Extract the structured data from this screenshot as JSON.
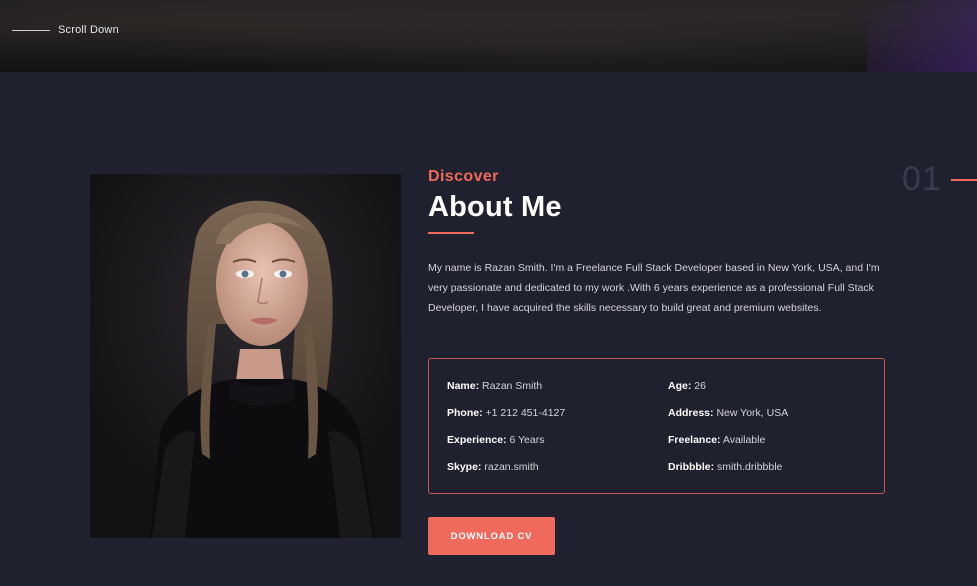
{
  "hero": {
    "scroll_label": "Scroll Down"
  },
  "about": {
    "eyebrow": "Discover",
    "title": "About Me",
    "section_number": "01",
    "bio": "My name is Razan Smith. I'm a Freelance Full Stack Developer based in New York, USA, and I'm very passionate and dedicated to my work .With 6 years experience as a professional Full Stack Developer, I have acquired the skills necessary to build great and premium websites.",
    "info": [
      {
        "label": "Name:",
        "value": "Razan Smith"
      },
      {
        "label": "Age:",
        "value": "26"
      },
      {
        "label": "Phone:",
        "value": "+1 212 451-4127"
      },
      {
        "label": "Address:",
        "value": "New York, USA"
      },
      {
        "label": "Experience:",
        "value": "6 Years"
      },
      {
        "label": "Freelance:",
        "value": "Available"
      },
      {
        "label": "Skype:",
        "value": "razan.smith"
      },
      {
        "label": "Dribbble:",
        "value": "smith.dribbble"
      }
    ],
    "download_label": "DOWNLOAD CV"
  },
  "colors": {
    "accent": "#ef6a5c",
    "background": "#20212e",
    "text": "#d4d5dc"
  }
}
